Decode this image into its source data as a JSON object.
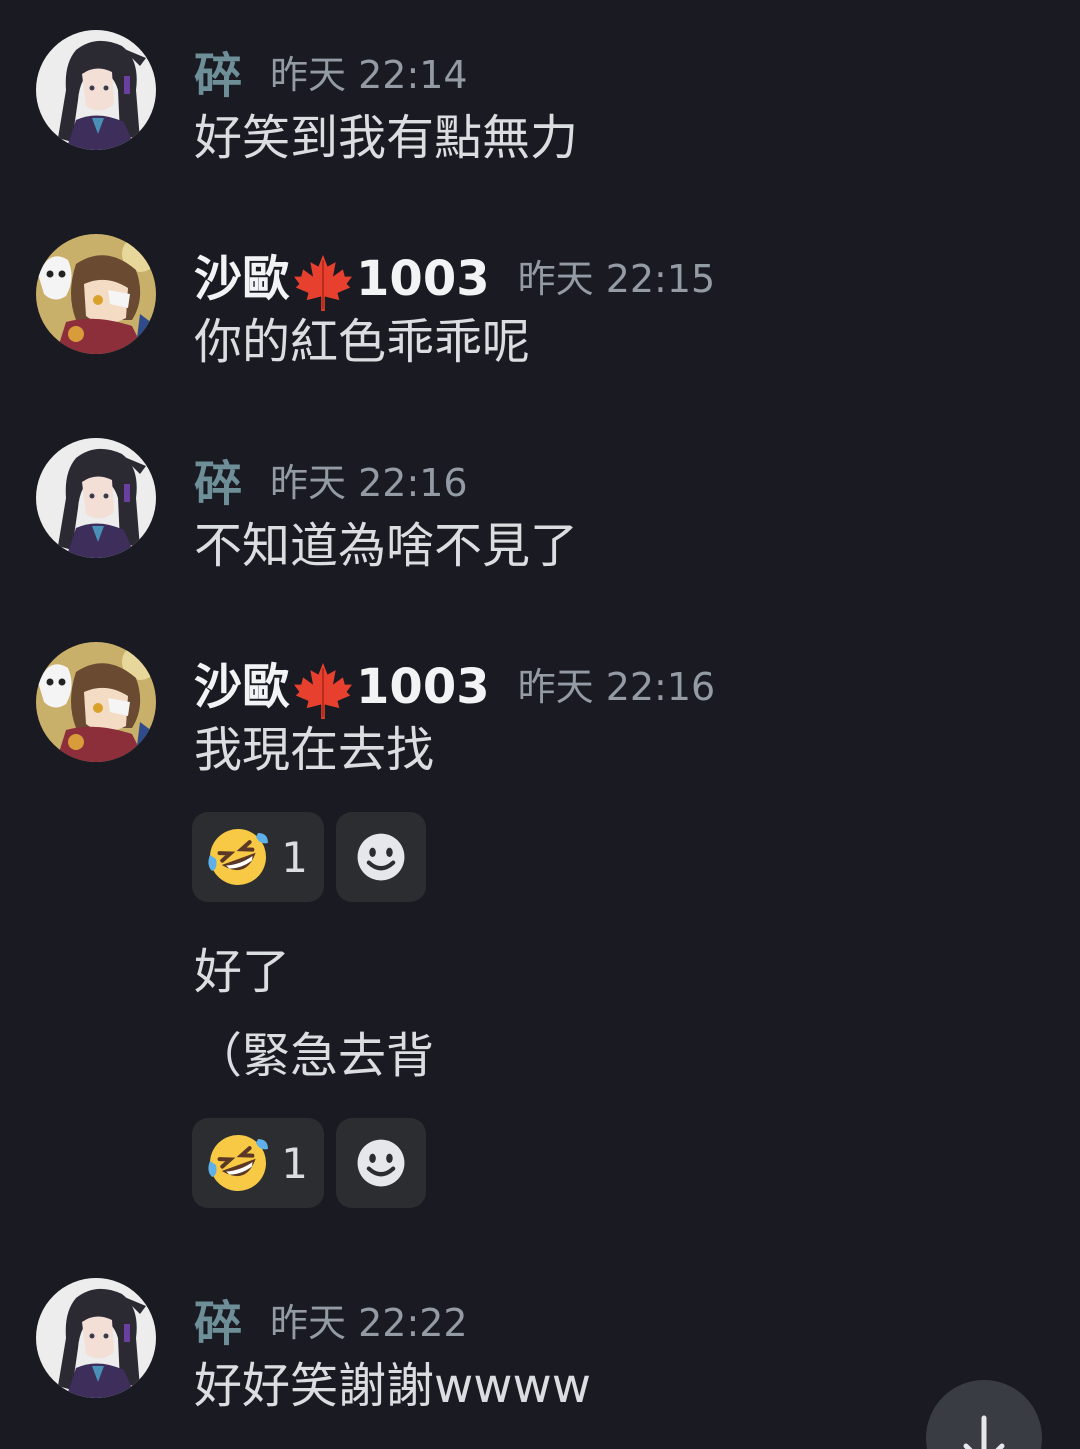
{
  "messages": [
    {
      "author": "碎",
      "time": "昨天 22:14",
      "text": "好笑到我有點無力"
    },
    {
      "author_prefix": "沙歐",
      "author_suffix": "1003",
      "time": "昨天 22:15",
      "text": "你的紅色乖乖呢"
    },
    {
      "author": "碎",
      "time": "昨天 22:16",
      "text": "不知道為啥不見了"
    },
    {
      "author_prefix": "沙歐",
      "author_suffix": "1003",
      "time": "昨天 22:16",
      "text": "我現在去找",
      "reaction": {
        "emoji": "rolling-on-floor-laughing",
        "count": "1"
      }
    },
    {
      "text": "好了",
      "continuation": true
    },
    {
      "text": "（緊急去背",
      "continuation": true,
      "reaction": {
        "emoji": "rolling-on-floor-laughing",
        "count": "1"
      }
    },
    {
      "author": "碎",
      "time": "昨天 22:22",
      "text": "好好笑謝謝wwww"
    }
  ],
  "icons": {
    "maple": "maple-leaf-icon",
    "add_reaction": "smiley-icon",
    "scroll_down": "arrow-down-icon"
  },
  "colors": {
    "background": "#1a1b22",
    "username_sui": "#6e8f98",
    "username_shaou": "#f2f3f5",
    "timestamp": "#949ba4",
    "message_text": "#dbdee1",
    "reaction_bg": "#2b2d31"
  }
}
